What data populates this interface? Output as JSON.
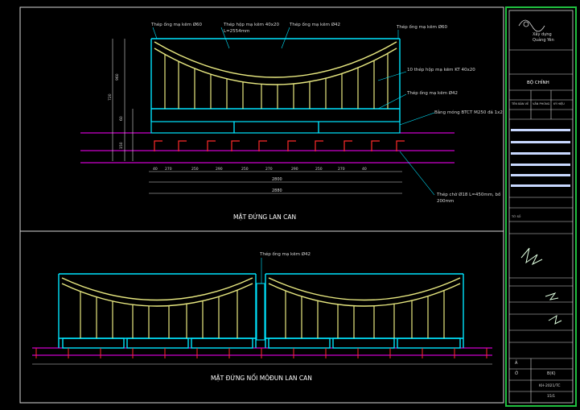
{
  "drawing": {
    "top_view_title": "MẶT ĐỨNG LAN CAN",
    "bottom_view_title": "MẶT ĐỨNG NỐI MÔĐUN LAN CAN",
    "callouts_top": {
      "post_pipe_60": "Thép ống mạ kẽm Ø60",
      "box_40x20": "Thép hộp mạ kẽm 40x20",
      "length": "L=2554mm",
      "pipe_42_top": "Thép ống mạ kẽm Ø42",
      "post_pipe_60_right": "Thép ống mạ kẽm Ø60",
      "box_kt": "10 thép hộp mạ kẽm KT 40x20",
      "pipe_42_mid": "Thép ống mạ kẽm Ø42",
      "foundation": "Bằng móng BTCT M250 đá 1x2",
      "anchor": "Thép chờ Ø18 L=450mm, bố",
      "anchor_2": "200mm"
    },
    "callouts_bottom": {
      "pipe_42": "Thép ống mạ kẽm Ø42"
    },
    "dims_bottom_row1": [
      "40",
      "270",
      "250",
      "290",
      "250",
      "270",
      "290",
      "250",
      "270",
      "40"
    ],
    "dim_total_inner": "2800",
    "dim_total_outer": "2880",
    "dims_left": [
      "960",
      "720",
      "60",
      "150"
    ],
    "colors": {
      "frame_cyan": "#00e5ff",
      "bar_yellow": "#e8e880",
      "magenta": "#ff00ff",
      "red": "#ff2a2a",
      "dim_white": "#d8d8d8",
      "border_green": "#20c040"
    }
  },
  "title_block": {
    "company_lines": [
      "Xây dựng",
      "Quảng Yên"
    ],
    "project_header": "BỘ CHỈNH",
    "label_ten_ban_ve": "TÊN BẢN VẼ",
    "label_tieu_de": "VĂN PHÒNG",
    "label_ky_hieu": "KÝ HIỆU",
    "label_sheet": "TỜ SỐ",
    "field_a": "Ả",
    "field_b": "Ở",
    "field_c": "B(K)",
    "field_d": "KH-2021/TC",
    "field_e": "15/1"
  }
}
